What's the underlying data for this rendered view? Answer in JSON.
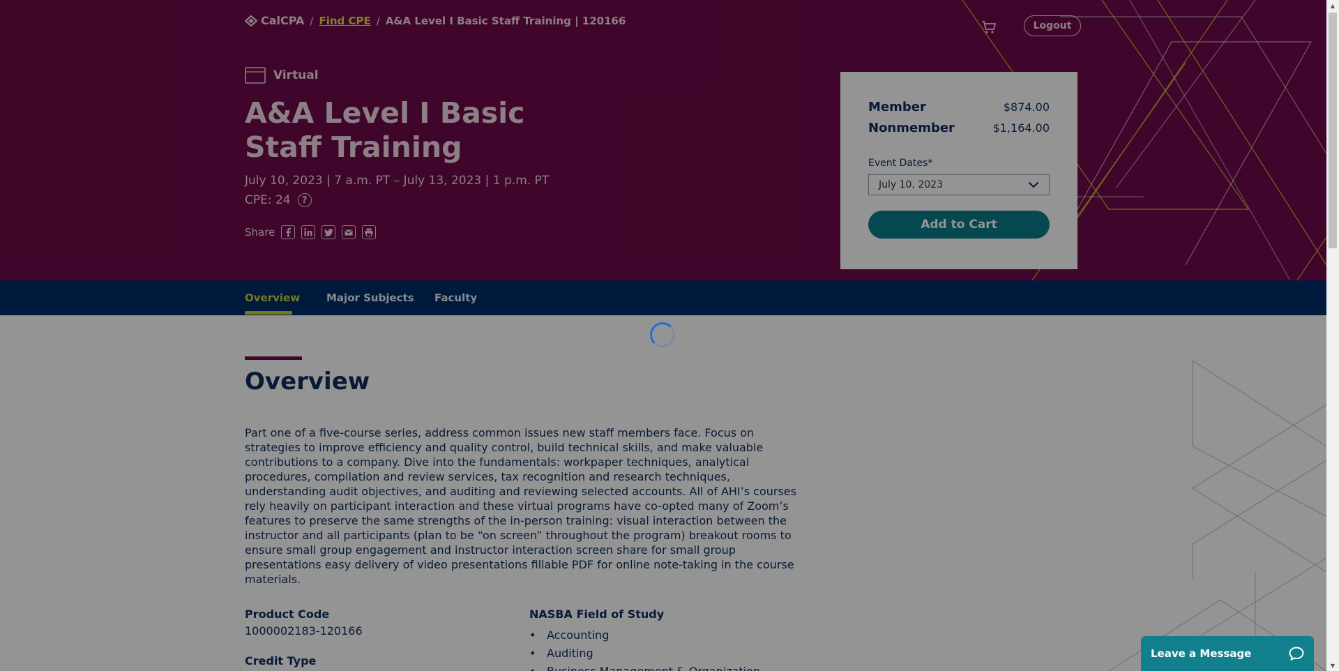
{
  "breadcrumb": {
    "brand": "CalCPA",
    "link": "Find CPE",
    "sep": "/",
    "current": "A&A Level I Basic Staff Training | 120166"
  },
  "header": {
    "logout": "Logout",
    "cart_icon": "cart-icon"
  },
  "course": {
    "format": "Virtual",
    "title": "A&A Level I Basic Staff Training",
    "dates": "July 10, 2023 | 7 a.m. PT – July 13, 2023 | 1 p.m. PT",
    "cpe": "CPE: 24",
    "help_glyph": "?",
    "share_label": "Share",
    "share_icons": [
      "facebook-icon",
      "linkedin-icon",
      "twitter-icon",
      "email-icon",
      "print-icon"
    ]
  },
  "pricing": {
    "member_label": "Member",
    "member_price": "$874.00",
    "nonmember_label": "Nonmember",
    "nonmember_price": "$1,164.00",
    "dates_label": "Event Dates*",
    "selected_date": "July 10, 2023",
    "add_to_cart": "Add to Cart"
  },
  "tabs": [
    "Overview",
    "Major Subjects",
    "Faculty"
  ],
  "overview": {
    "heading": "Overview",
    "body": "Part one of a five-course series, address common issues new staff members face. Focus on strategies to improve efficiency and quality control, build technical skills, and make valuable contributions to a company. Dive into the fundamentals: workpaper techniques, analytical procedures, compilation and review services, tax recognition and research techniques, understanding audit objectives, and auditing and reviewing selected accounts. All of AHI’s courses rely heavily on participant interaction and these virtual programs have co-opted many of Zoom’s features to preserve the same strengths of the in-person training: visual interaction between the instructor and all participants (plan to be “on screen” throughout the program) breakout rooms to ensure small group engagement and instructor interaction screen share for small group presentations easy delivery of video presentations fillable PDF for online note-taking in the course materials."
  },
  "details": {
    "product_code_label": "Product Code",
    "product_code": "1000002183-120166",
    "credit_type_label": "Credit Type",
    "nasba_label": "NASBA Field of Study",
    "nasba_fields": [
      "Accounting",
      "Auditing",
      "Business Management & Organization"
    ]
  },
  "chat": {
    "label": "Leave a Message"
  },
  "colors": {
    "hero": "#6e0a49",
    "nav": "#002d6a",
    "accent": "#c7d43a",
    "button": "#0b7d8a",
    "text": "#0f2d5e"
  }
}
